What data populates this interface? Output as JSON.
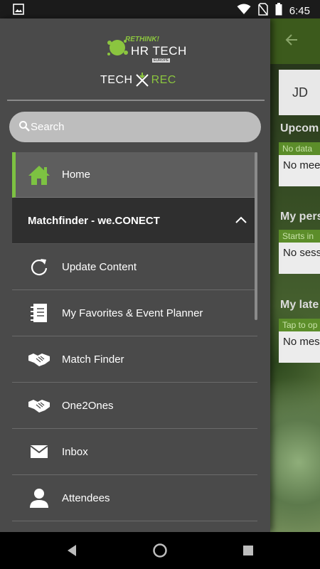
{
  "status_bar": {
    "time": "6:45"
  },
  "drawer": {
    "logo": {
      "tagline": "RETHINK!",
      "event": "HR TECH",
      "region": "EUROPE",
      "brand_left": "TECH",
      "brand_right": "REC"
    },
    "search": {
      "placeholder": "Search"
    },
    "home_label": "Home",
    "section_title": "Matchfinder - we.CONECT",
    "items": [
      {
        "label": "Update Content",
        "icon": "refresh-icon"
      },
      {
        "label": "My Favorites & Event Planner",
        "icon": "planner-icon"
      },
      {
        "label": "Match Finder",
        "icon": "handshake-icon"
      },
      {
        "label": "One2Ones",
        "icon": "handshake-icon"
      },
      {
        "label": "Inbox",
        "icon": "envelope-icon"
      },
      {
        "label": "Attendees",
        "icon": "person-icon"
      }
    ]
  },
  "background_app": {
    "avatar_initials": "JD",
    "sections": [
      {
        "title": "Upcom",
        "strip": "No data",
        "card": "No mee"
      },
      {
        "title": "My pers",
        "strip": "Starts in",
        "card": "No sess"
      },
      {
        "title": "My late",
        "strip": "Tap to op",
        "card": "No mes"
      }
    ]
  },
  "colors": {
    "accent_green": "#7dc242",
    "drawer_bg": "#4a4a4a",
    "section_bg": "#2f2f2f",
    "search_bg": "#bdbdbd"
  }
}
